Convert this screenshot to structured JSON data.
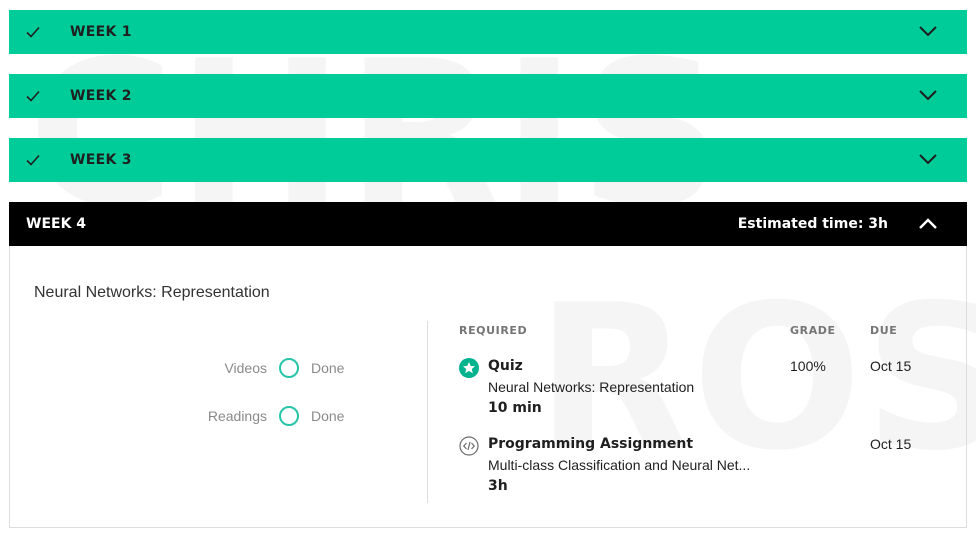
{
  "watermark": {
    "line1": "CHRIS",
    "line2": "ROS"
  },
  "weeks": [
    {
      "label": "WEEK 1",
      "completed": true
    },
    {
      "label": "WEEK 2",
      "completed": true
    },
    {
      "label": "WEEK 3",
      "completed": true
    }
  ],
  "week4": {
    "label": "WEEK 4",
    "estimated_time": "Estimated time: 3h",
    "module_title": "Neural Networks: Representation",
    "progress": [
      {
        "label": "Videos",
        "status": "Done"
      },
      {
        "label": "Readings",
        "status": "Done"
      }
    ],
    "columns": {
      "required": "REQUIRED",
      "grade": "GRADE",
      "due": "DUE"
    },
    "items": [
      {
        "type": "Quiz",
        "title": "Neural Networks: Representation",
        "time": "10 min",
        "grade": "100%",
        "due": "Oct 15",
        "icon": "star-badge-icon"
      },
      {
        "type": "Programming Assignment",
        "title": "Multi-class Classification and Neural Net...",
        "time": "3h",
        "grade": "",
        "due": "Oct 15",
        "icon": "code-icon"
      }
    ]
  },
  "colors": {
    "accent": "#00cc99",
    "header_dark": "#000000",
    "progress_ring": "#27c4a8"
  }
}
